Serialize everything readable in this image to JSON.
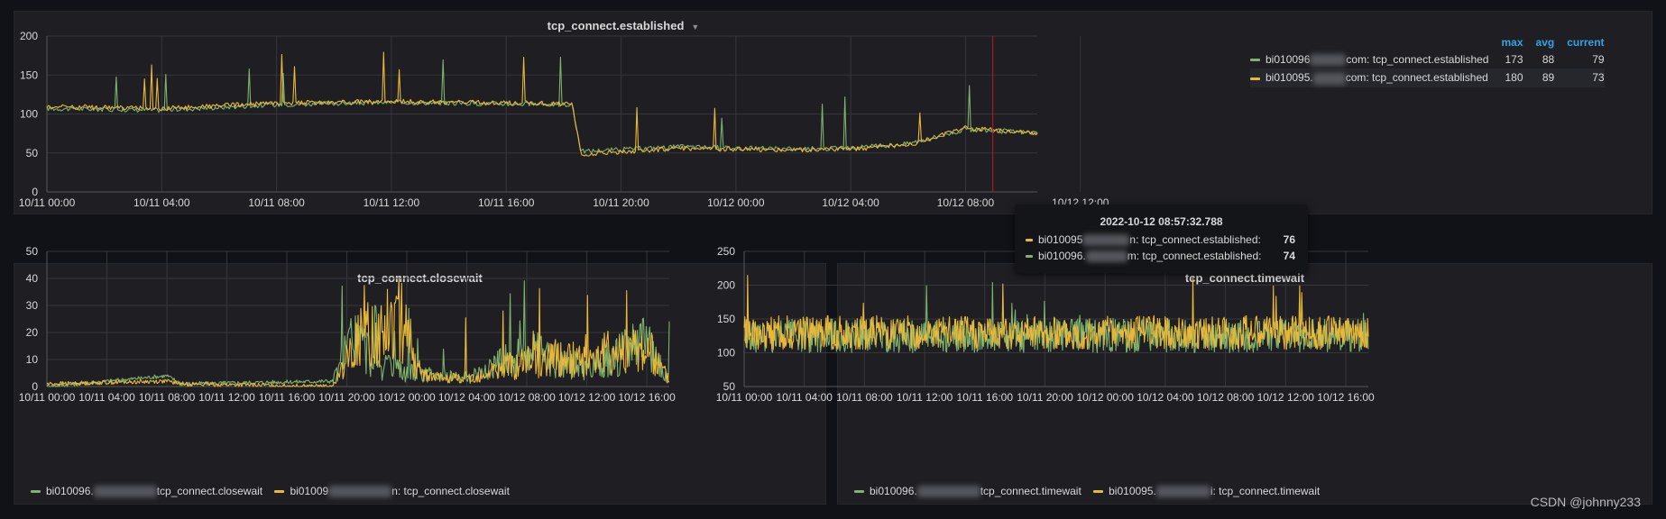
{
  "colors": {
    "green": "#7eb26d",
    "yellow": "#eab839",
    "accent": "#33a2e5",
    "crosshair": "#c4162a"
  },
  "panels": {
    "established": {
      "title": "tcp_connect.established",
      "legend": {
        "headers": [
          "max",
          "avg",
          "current"
        ],
        "rows": [
          {
            "prefix": "bi010096",
            "suffix": "com: tcp_connect.established",
            "color": "green",
            "max": "173",
            "avg": "88",
            "current": "79"
          },
          {
            "prefix": "bi010095.",
            "suffix": "com: tcp_connect.established",
            "color": "yellow",
            "max": "180",
            "avg": "89",
            "current": "73"
          }
        ]
      }
    },
    "closewait": {
      "title": "tcp_connect.closewait",
      "legend": [
        {
          "prefix": "bi010096.",
          "suffix": "tcp_connect.closewait",
          "color": "green"
        },
        {
          "prefix": "bi01009",
          "suffix": "n: tcp_connect.closewait",
          "color": "yellow"
        }
      ]
    },
    "timewait": {
      "title": "tcp_connect.timewait",
      "legend": [
        {
          "prefix": "bi010096.",
          "suffix": "tcp_connect.timewait",
          "color": "green"
        },
        {
          "prefix": "bi010095.",
          "suffix": "i: tcp_connect.timewait",
          "color": "yellow"
        }
      ]
    }
  },
  "tooltip": {
    "time": "2022-10-12 08:57:32.788",
    "rows": [
      {
        "prefix": "bi010095",
        "suffix": "n: tcp_connect.established:",
        "value": "76",
        "color": "yellow"
      },
      {
        "prefix": "bi010096.",
        "suffix": "m: tcp_connect.established:",
        "value": "74",
        "color": "green"
      }
    ]
  },
  "watermark": "CSDN @johnny233",
  "chart_data": [
    {
      "type": "line",
      "title": "tcp_connect.established",
      "x_range": [
        "10/11 00:00",
        "10/12 10:30"
      ],
      "x_ticks": [
        "10/11 00:00",
        "10/11 04:00",
        "10/11 08:00",
        "10/11 12:00",
        "10/11 16:00",
        "10/11 20:00",
        "10/12 00:00",
        "10/12 04:00",
        "10/12 08:00",
        "10/12 12:00"
      ],
      "y_ticks": [
        "0",
        "50",
        "100",
        "150",
        "200"
      ],
      "ylim": [
        0,
        200
      ],
      "grid": true,
      "legend_position": "right",
      "crosshair_time": "10/12 08:57",
      "series": [
        {
          "name": "bi010096.…com: tcp_connect.established",
          "color": "green",
          "hours": [
            0,
            4,
            8,
            12,
            18.3,
            18.6,
            22,
            26,
            28,
            30,
            32,
            34.5
          ],
          "values": [
            107,
            105,
            112,
            115,
            112,
            52,
            58,
            55,
            56,
            62,
            80,
            76
          ]
        },
        {
          "name": "bi010095.…com: tcp_connect.established",
          "color": "yellow",
          "hours": [
            0,
            4,
            8,
            12,
            18.3,
            18.6,
            22,
            26,
            28,
            30,
            32,
            34.5
          ],
          "values": [
            110,
            107,
            114,
            116,
            113,
            48,
            56,
            54,
            55,
            60,
            82,
            75
          ]
        }
      ]
    },
    {
      "type": "line",
      "title": "tcp_connect.closewait",
      "x_range": [
        "10/11 00:00",
        "10/12 16:30"
      ],
      "x_ticks": [
        "10/11 00:00",
        "10/11 04:00",
        "10/11 08:00",
        "10/11 12:00",
        "10/11 16:00",
        "10/11 20:00",
        "10/12 00:00",
        "10/12 04:00",
        "10/12 08:00",
        "10/12 12:00",
        "10/12 16:00"
      ],
      "y_ticks": [
        "0",
        "10",
        "20",
        "30",
        "40",
        "50"
      ],
      "ylim": [
        0,
        50
      ],
      "grid": true,
      "legend_position": "bottom",
      "series": [
        {
          "name": "bi010096.…tcp_connect.closewait",
          "color": "green",
          "hours": [
            0,
            8,
            9,
            19,
            20.5,
            22,
            24,
            28,
            32,
            36,
            40,
            41.5
          ],
          "values": [
            0,
            4,
            1,
            2,
            30,
            12,
            8,
            5,
            20,
            10,
            25,
            3
          ]
        },
        {
          "name": "bi01009…n: tcp_connect.closewait",
          "color": "yellow",
          "hours": [
            0,
            8,
            9,
            19,
            21,
            23.5,
            25,
            28,
            32,
            36,
            40,
            41.5
          ],
          "values": [
            1,
            2,
            1,
            0,
            28,
            40,
            6,
            4,
            15,
            18,
            22,
            4
          ]
        }
      ]
    },
    {
      "type": "line",
      "title": "tcp_connect.timewait",
      "x_range": [
        "10/11 00:00",
        "10/12 16:30"
      ],
      "x_ticks": [
        "10/11 00:00",
        "10/11 04:00",
        "10/11 08:00",
        "10/11 12:00",
        "10/11 16:00",
        "10/11 20:00",
        "10/12 00:00",
        "10/12 04:00",
        "10/12 08:00",
        "10/12 12:00",
        "10/12 16:00"
      ],
      "y_ticks": [
        "50",
        "100",
        "150",
        "200",
        "250"
      ],
      "ylim": [
        50,
        250
      ],
      "grid": true,
      "legend_position": "bottom",
      "series": [
        {
          "name": "bi010096.…tcp_connect.timewait",
          "color": "green",
          "low": 100,
          "high": 150,
          "peak": 205
        },
        {
          "name": "bi010095.…i: tcp_connect.timewait",
          "color": "yellow",
          "low": 105,
          "high": 155,
          "peak": 215
        }
      ]
    }
  ]
}
